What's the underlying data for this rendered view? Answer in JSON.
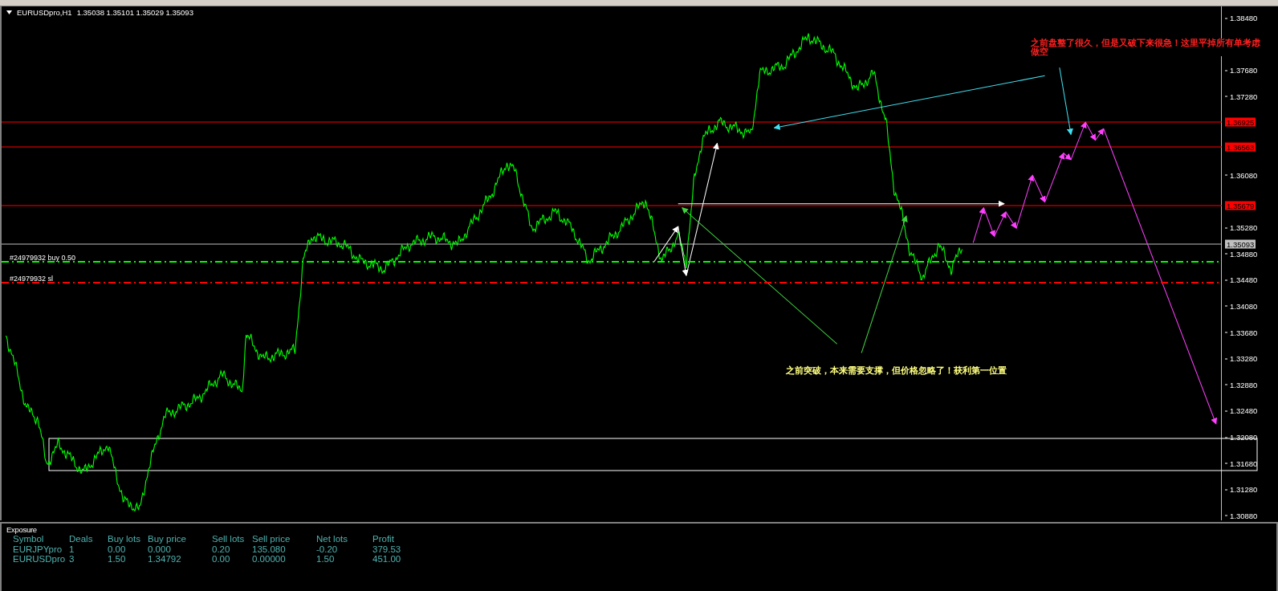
{
  "chart": {
    "symbol": "EURUSDpro,H1",
    "ohlc": "1.35038 1.35101 1.35029 1.35093",
    "price_axis": [
      "1.38480",
      "1.37680",
      "1.37280",
      "1.36080",
      "1.35280",
      "1.34880",
      "1.34480",
      "1.34080",
      "1.33680",
      "1.33280",
      "1.32880",
      "1.32480",
      "1.32080",
      "1.31680",
      "1.31280",
      "1.30880"
    ],
    "price_lines": [
      {
        "tag": "1.36925",
        "color": "#ff0000"
      },
      {
        "tag": "1.36563",
        "color": "#ff0000"
      },
      {
        "tag": "1.35679",
        "color": "#ff0000"
      },
      {
        "tag": "1.35093",
        "color": "#c0c0c0"
      }
    ],
    "orders": [
      {
        "label": "#24979932 buy 0.50",
        "color": "#00ff00"
      },
      {
        "label": "#24979932 sl",
        "color": "#ff0000"
      }
    ],
    "annotations": [
      {
        "lines": [
          "之前盘整了很久，但是又破下来很急！这里平掉所有单考虑",
          "做空"
        ],
        "color": "#ff2020"
      },
      {
        "lines": [
          "之前突破，本来需要支撑，但价格忽略了！获利第一位置"
        ],
        "color": "#ffff80"
      }
    ]
  },
  "exposure": {
    "title": "Exposure",
    "columns": [
      "Symbol",
      "Deals",
      "Buy lots",
      "Buy price",
      "Sell lots",
      "Sell price",
      "Net lots",
      "Profit"
    ],
    "rows": [
      [
        "EURJPYpro",
        "1",
        "0.00",
        "0.000",
        "0.20",
        "135.080",
        "-0.20",
        "379.53"
      ],
      [
        "EURUSDpro",
        "3",
        "1.50",
        "1.34792",
        "0.00",
        "0.00000",
        "1.50",
        "451.00"
      ]
    ]
  }
}
